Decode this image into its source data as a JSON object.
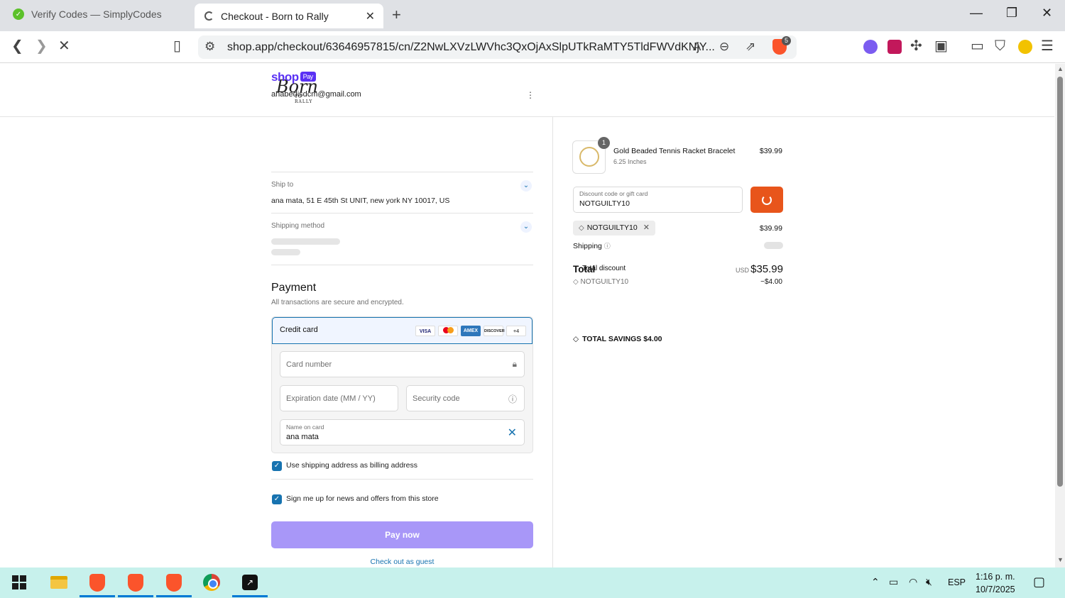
{
  "browser": {
    "tabs": [
      {
        "title": "Verify Codes — SimplyCodes",
        "active": false
      },
      {
        "title": "Checkout - Born to Rally",
        "active": true
      }
    ],
    "url": "shop.app/checkout/63646957815/cn/Z2NwLXVzLWVhc3QxOjAxSlpUTkRaMTY5TldFWVdKNjY...",
    "shields_count": "5",
    "icons": {
      "back": "back-arrow-icon",
      "forward": "forward-arrow-icon",
      "reload": "stop-loading-icon",
      "bookmark": "bookmark-icon",
      "site_settings": "tune-icon",
      "translate": "translate-icon",
      "zoom": "zoom-out-icon",
      "share": "share-icon",
      "extensions": "puzzle-icon",
      "wallet": "wallet-icon",
      "vpn": "vpn-icon",
      "menu": "hamburger-menu-icon"
    }
  },
  "store": {
    "logo_text": "Born",
    "logo_sub": "TO RALLY"
  },
  "checkout": {
    "shop_pay": {
      "brand": "shop",
      "badge": "Pay"
    },
    "email": "anabedisdcm@gmail.com",
    "ship_to": {
      "label": "Ship to",
      "address": "ana mata, 51 E 45th St UNIT, new york NY 10017, US"
    },
    "shipping_method": {
      "label": "Shipping method"
    },
    "payment": {
      "title": "Payment",
      "subtitle": "All transactions are secure and encrypted.",
      "method_label": "Credit card",
      "cards": [
        "VISA",
        "MC",
        "AMEX",
        "DISCOVER"
      ],
      "more_cards": "+4",
      "card_number_placeholder": "Card number",
      "expiration_placeholder": "Expiration date (MM / YY)",
      "security_placeholder": "Security code",
      "name_label": "Name on card",
      "name_value": "ana mata"
    },
    "billing_checkbox": "Use shipping address as billing address",
    "news_checkbox": "Sign me up for news and offers from this store",
    "pay_now": "Pay now",
    "guest": "Check out as guest"
  },
  "summary": {
    "product": {
      "qty": "1",
      "name": "Gold Beaded Tennis Racket Bracelet",
      "variant": "6.25 Inches",
      "price": "$39.99"
    },
    "discount_field": {
      "label": "Discount code or gift card",
      "value": "NOTGUILTY10"
    },
    "applied_code": "NOTGUILTY10",
    "subtotal": "$39.99",
    "shipping_label": "Shipping",
    "total_label": "Total",
    "total_discount_label": "Total discount",
    "currency": "USD",
    "total": "$35.99",
    "discount_code": "NOTGUILTY10",
    "discount_amount": "−$4.00",
    "savings_label": "TOTAL SAVINGS",
    "savings_amount": "$4.00"
  },
  "taskbar": {
    "language": "ESP",
    "time": "1:16 p. m.",
    "date": "10/7/2025"
  },
  "colors": {
    "accent": "#1773b0",
    "shop_pay": "#5a31f4",
    "apply_button": "#e8551b",
    "pay_now_disabled": "#a897f8",
    "taskbar": "#c7f1ec"
  }
}
